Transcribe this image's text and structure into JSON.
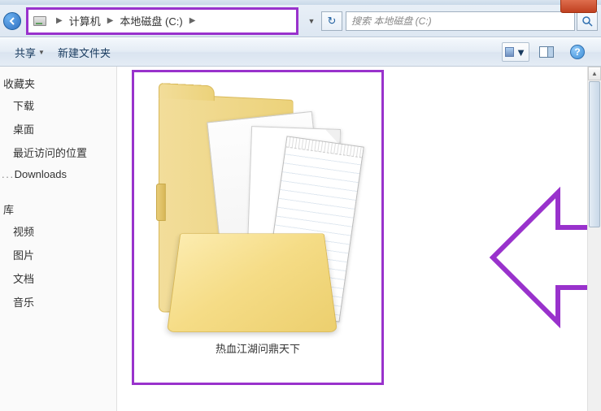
{
  "window": {
    "close_label": "×"
  },
  "addressbar": {
    "crumb1": "计算机",
    "crumb2": "本地磁盘 (C:)",
    "search_placeholder": "搜索 本地磁盘 (C:)"
  },
  "toolbar": {
    "share_label": "共享",
    "newfolder_label": "新建文件夹",
    "help_label": "?"
  },
  "sidebar": {
    "favorites_label": "收藏夹",
    "items": [
      {
        "label": "下载"
      },
      {
        "label": "桌面"
      },
      {
        "label": "最近访问的位置"
      },
      {
        "label": "Downloads"
      }
    ],
    "libraries_label": "库",
    "lib_items": [
      {
        "label": "视频"
      },
      {
        "label": "图片"
      },
      {
        "label": "文档"
      },
      {
        "label": "音乐"
      }
    ]
  },
  "main": {
    "folder_name": "热血江湖问鼎天下"
  },
  "colors": {
    "highlight": "#9932cc"
  }
}
